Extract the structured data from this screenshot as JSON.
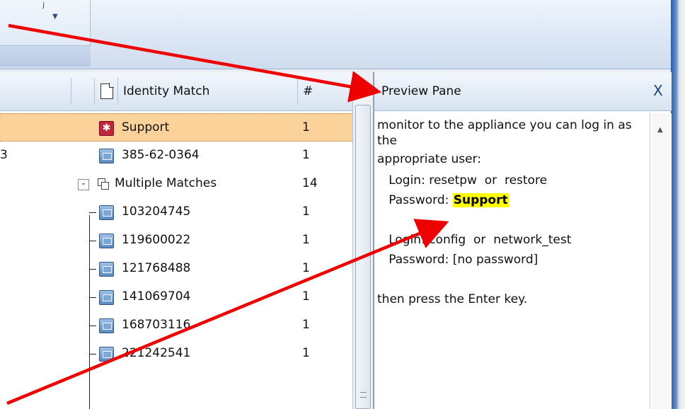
{
  "list": {
    "header": {
      "identity_label": "Identity Match",
      "count_label": "#"
    },
    "rows": [
      {
        "name": "Support",
        "count": "1",
        "icon": "star-icon",
        "selected": true
      },
      {
        "partial": "3",
        "name": "385-62-0364",
        "count": "1",
        "icon": "id-card-icon"
      },
      {
        "name": "Multiple Matches",
        "count": "14",
        "icon": "multiple-windows-icon",
        "expander": "-"
      },
      {
        "name": "103204745",
        "count": "1",
        "icon": "id-card-icon"
      },
      {
        "name": "119600022",
        "count": "1",
        "icon": "id-card-icon"
      },
      {
        "name": "121768488",
        "count": "1",
        "icon": "id-card-icon"
      },
      {
        "name": "141069704",
        "count": "1",
        "icon": "id-card-icon"
      },
      {
        "name": "168703116",
        "count": "1",
        "icon": "id-card-icon"
      },
      {
        "name": "221242541",
        "count": "1",
        "icon": "id-card-icon"
      }
    ]
  },
  "preview": {
    "title": "Preview Pane",
    "close_label": "X",
    "lines": [
      "monitor to the appliance you can log in as",
      "the",
      "appropriate user:",
      "   Login: resetpw  or  restore",
      "   Password: ",
      "",
      "   Login: config  or  network_test",
      "   Password: [no password]",
      "",
      "then press the Enter key."
    ],
    "highlight_word": "Support"
  },
  "colors": {
    "selection": "#fbd39a",
    "highlight": "#ffff00",
    "annotation": "#ee0000"
  }
}
